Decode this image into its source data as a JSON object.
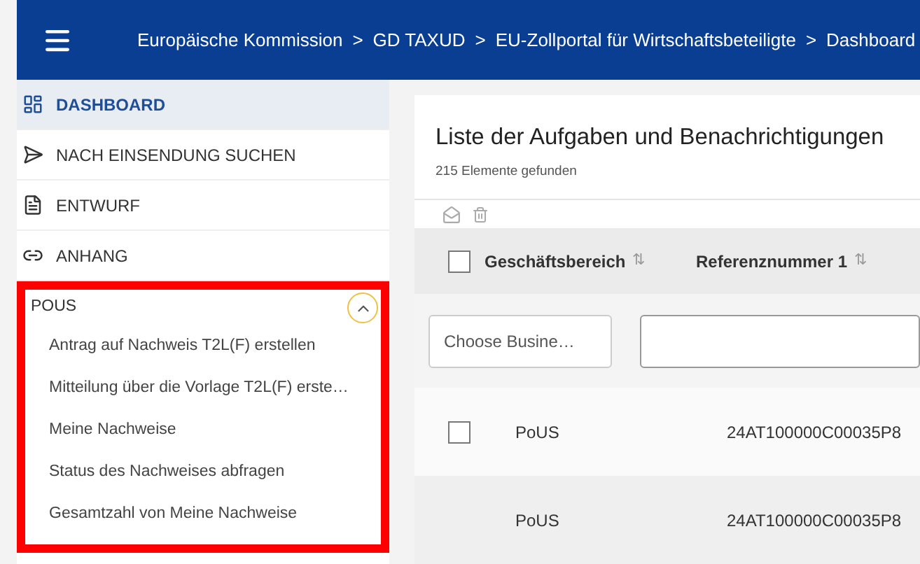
{
  "header": {
    "breadcrumbs": [
      "Europäische Kommission",
      "GD TAXUD",
      "EU-Zollportal für Wirtschaftsbeteiligte",
      "Dashboard"
    ],
    "separator": ">"
  },
  "sidebar": {
    "items": [
      {
        "label": "DASHBOARD",
        "selected": true
      },
      {
        "label": "NACH EINSENDUNG SUCHEN",
        "selected": false
      },
      {
        "label": "ENTWURF",
        "selected": false
      },
      {
        "label": "ANHANG",
        "selected": false
      }
    ],
    "section": {
      "title": "POUS",
      "expanded": true,
      "highlighted": true,
      "items": [
        "Antrag auf Nachweis T2L(F) erstellen",
        "Mitteilung über die Vorlage T2L(F) erste…",
        "Meine Nachweise",
        "Status des Nachweises abfragen",
        "Gesamtzahl von Meine Nachweise"
      ]
    }
  },
  "main": {
    "title": "Liste der Aufgaben und Benachrichtigungen",
    "count": "215 Elemente gefunden",
    "table": {
      "header_checked": false,
      "columns": [
        {
          "label": "Geschäftsbereich",
          "sort": "⇅"
        },
        {
          "label": "Referenznummer 1",
          "sort": "⇅"
        }
      ],
      "filters": [
        {
          "kind": "select",
          "placeholder": "Choose Busine…"
        },
        {
          "kind": "text"
        }
      ],
      "rows": [
        {
          "checked": false,
          "cells": [
            "PoUS",
            "24AT100000C00035P8"
          ]
        },
        {
          "cells": [
            "PoUS",
            "24AT100000C00035P8"
          ]
        }
      ]
    }
  }
}
